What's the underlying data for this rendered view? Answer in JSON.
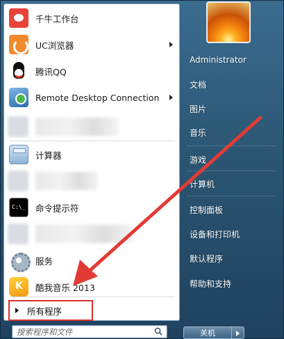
{
  "pinned_programs": [
    {
      "label": "千牛工作台",
      "icon": "qianniu-icon",
      "has_submenu": false
    },
    {
      "label": "UC浏览器",
      "icon": "uc-browser-icon",
      "has_submenu": true
    },
    {
      "label": "腾讯QQ",
      "icon": "qq-penguin-icon",
      "has_submenu": false
    },
    {
      "label": "Remote Desktop Connection",
      "icon": "remote-desktop-icon",
      "has_submenu": true
    }
  ],
  "recent_programs": [
    {
      "label": "计算器",
      "icon": "calculator-icon"
    },
    {
      "label": "命令提示符",
      "icon": "command-prompt-icon"
    },
    {
      "label": "服务",
      "icon": "services-gear-icon"
    },
    {
      "label": "酷我音乐 2013",
      "icon": "kuwo-music-icon"
    }
  ],
  "all_programs_label": "所有程序",
  "search": {
    "placeholder": "搜索程序和文件",
    "icon": "magnifier-icon"
  },
  "right_pane": {
    "user_name": "Administrator",
    "items": [
      {
        "label": "文档"
      },
      {
        "label": "图片"
      },
      {
        "label": "音乐"
      },
      {
        "label": "游戏"
      },
      {
        "label": "计算机"
      },
      {
        "label": "控制面板"
      },
      {
        "label": "设备和打印机"
      },
      {
        "label": "默认程序"
      },
      {
        "label": "帮助和支持"
      }
    ]
  },
  "shutdown": {
    "label": "关机",
    "arrow_icon": "triangle-right-icon"
  },
  "colors": {
    "highlight_box": "#d9302c",
    "annotation_arrow": "#e23b36",
    "right_pane_bg": "#2b5673"
  }
}
